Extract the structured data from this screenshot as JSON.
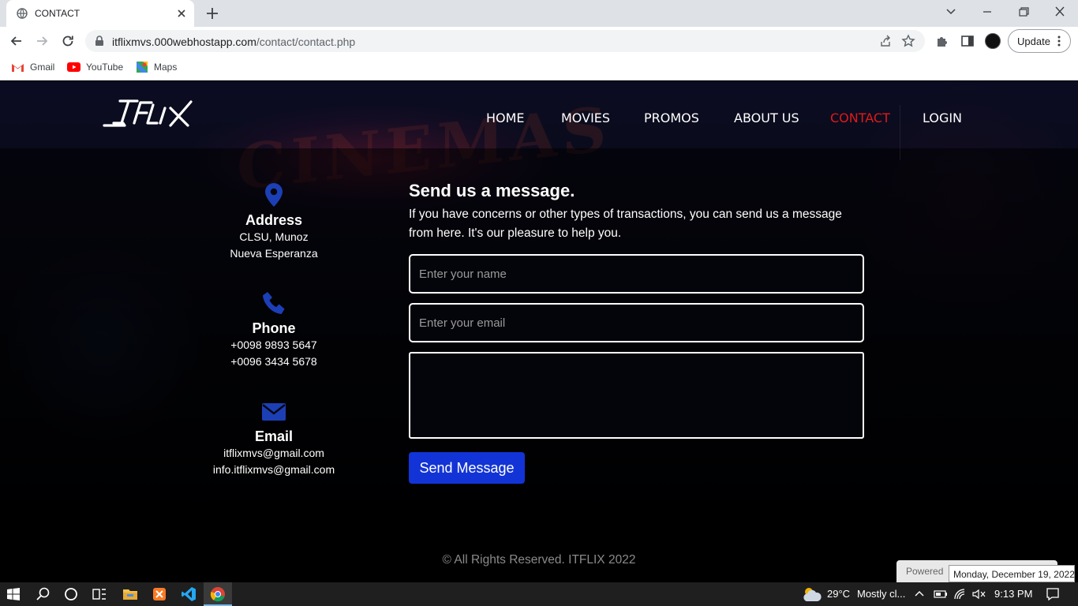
{
  "browser": {
    "tab_title": "CONTACT",
    "url_host": "itflixmvs.000webhostapp.com",
    "url_path": "/contact/contact.php",
    "update_label": "Update",
    "bookmarks": [
      {
        "label": "Gmail",
        "icon": "gmail-icon"
      },
      {
        "label": "YouTube",
        "icon": "youtube-icon"
      },
      {
        "label": "Maps",
        "icon": "maps-icon"
      }
    ]
  },
  "site": {
    "logo_text": "ITFLIX",
    "background_text": "CINEMAS",
    "nav": [
      {
        "label": "HOME",
        "active": false
      },
      {
        "label": "MOVIES",
        "active": false
      },
      {
        "label": "PROMOS",
        "active": false
      },
      {
        "label": "ABOUT US",
        "active": false
      },
      {
        "label": "CONTACT",
        "active": true
      },
      {
        "label": "LOGIN",
        "active": false
      }
    ],
    "active_color": "#e01a1a",
    "accent_blue": "#1234d6",
    "info": {
      "address": {
        "title": "Address",
        "line1": "CLSU, Munoz",
        "line2": "Nueva Esperanza",
        "icon": "map-pin-icon"
      },
      "phone": {
        "title": "Phone",
        "line1": "+0098 9893 5647",
        "line2": "+0096 3434 5678",
        "icon": "phone-icon"
      },
      "email": {
        "title": "Email",
        "line1": "itflixmvs@gmail.com",
        "line2": "info.itflixmvs@gmail.com",
        "icon": "envelope-icon"
      }
    },
    "form": {
      "title": "Send us a message.",
      "description": "If you have concerns or other types of transactions, you can send us a message from here. It's our pleasure to help you.",
      "name_placeholder": "Enter your name",
      "email_placeholder": "Enter your email",
      "message_value": "",
      "send_label": "Send Message"
    },
    "footer": "© All Rights Reserved. ITFLIX 2022",
    "powered_label": "Powered"
  },
  "tooltip": "Monday, December 19, 2022",
  "taskbar": {
    "weather": "29°C",
    "weather_desc": "Mostly cl...",
    "time": "9:13 PM"
  }
}
